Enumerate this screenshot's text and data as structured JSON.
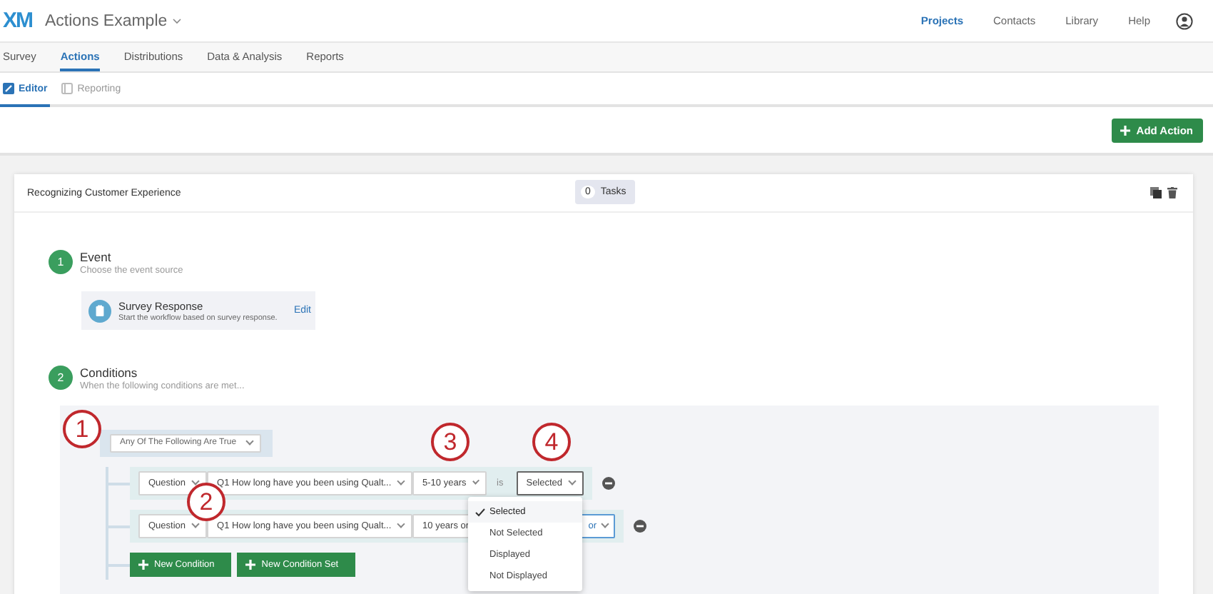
{
  "app": {
    "logo": "XM",
    "title": "Actions Example"
  },
  "nav": [
    {
      "label": "Projects",
      "selected": true
    },
    {
      "label": "Contacts",
      "selected": false
    },
    {
      "label": "Library",
      "selected": false
    },
    {
      "label": "Help",
      "selected": false
    }
  ],
  "tabs": [
    {
      "label": "Survey",
      "selected": false
    },
    {
      "label": "Actions",
      "selected": true
    },
    {
      "label": "Distributions",
      "selected": false
    },
    {
      "label": "Data & Analysis",
      "selected": false
    },
    {
      "label": "Reports",
      "selected": false
    }
  ],
  "subtabs": [
    {
      "label": "Editor",
      "selected": true
    },
    {
      "label": "Reporting",
      "selected": false
    }
  ],
  "add_action": "Add Action",
  "action": {
    "title": "Recognizing Customer Experience",
    "task_count": "0",
    "task_label": "Tasks"
  },
  "steps": [
    {
      "number": "1",
      "title": "Event",
      "subtitle": "Choose the event source"
    },
    {
      "number": "2",
      "title": "Conditions",
      "subtitle": "When the following conditions are met..."
    }
  ],
  "event_source": {
    "title": "Survey Response",
    "description": "Start the workflow based on survey response.",
    "edit": "Edit"
  },
  "conditions": {
    "group": "Any Of The Following Are True",
    "rows": [
      {
        "type": "Question",
        "question": "Q1 How long have you been using Qualt...",
        "answer": "5-10 years",
        "operator_label": "is",
        "operator": "Selected",
        "open": true,
        "highlighted": false
      },
      {
        "type": "Question",
        "question": "Q1 How long have you been using Qualt...",
        "answer": "10 years or",
        "operator": "or",
        "open": false,
        "highlighted": true
      }
    ],
    "buttons": [
      "New Condition",
      "New Condition Set"
    ]
  },
  "dropdown_menu": [
    {
      "label": "Selected",
      "selected": true
    },
    {
      "label": "Not Selected",
      "selected": false
    },
    {
      "label": "Displayed",
      "selected": false
    },
    {
      "label": "Not Displayed",
      "selected": false
    }
  ],
  "annotations": [
    "1",
    "2",
    "3",
    "4"
  ]
}
